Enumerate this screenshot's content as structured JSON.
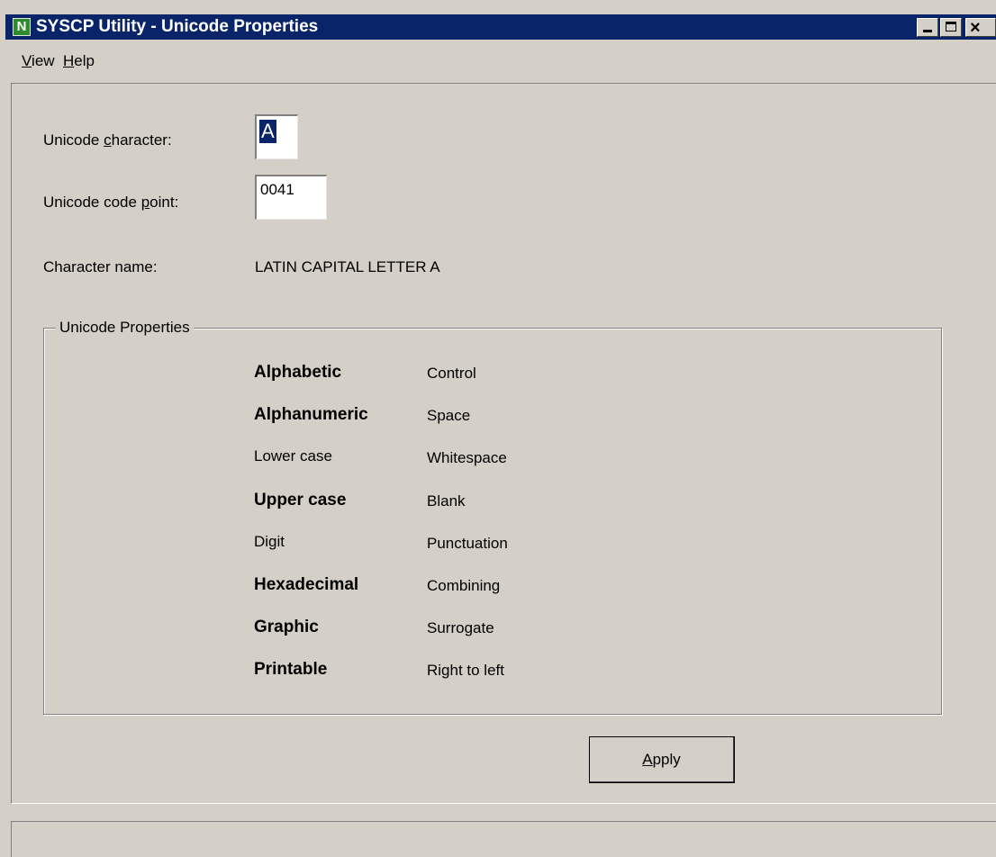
{
  "window": {
    "title": "SYSCP Utility - Unicode Properties",
    "app_icon_letter": "N",
    "controls": [
      "minimize-icon",
      "maximize-icon",
      "close-icon"
    ]
  },
  "menu": {
    "view": {
      "mnemonic": "V",
      "rest": "iew"
    },
    "help": {
      "mnemonic": "H",
      "rest": "elp"
    }
  },
  "form": {
    "char_label": {
      "pre": "Unicode ",
      "mnemonic": "c",
      "post": "haracter:"
    },
    "char_value": "A",
    "codepoint_label": {
      "pre": "Unicode code ",
      "mnemonic": "p",
      "post": "oint:"
    },
    "codepoint_value": "0041",
    "name_label": "Character name:",
    "name_value": "LATIN CAPITAL LETTER A"
  },
  "properties": {
    "legend": "Unicode Properties",
    "left": [
      {
        "label": "Alphabetic",
        "active": true
      },
      {
        "label": "Alphanumeric",
        "active": true
      },
      {
        "label": "Lower case",
        "active": false
      },
      {
        "label": "Upper case",
        "active": true
      },
      {
        "label": "Digit",
        "active": false
      },
      {
        "label": "Hexadecimal",
        "active": true
      },
      {
        "label": "Graphic",
        "active": true
      },
      {
        "label": "Printable",
        "active": true
      }
    ],
    "right": [
      {
        "label": "Control",
        "active": false
      },
      {
        "label": "Space",
        "active": false
      },
      {
        "label": "Whitespace",
        "active": false
      },
      {
        "label": "Blank",
        "active": false
      },
      {
        "label": "Punctuation",
        "active": false
      },
      {
        "label": "Combining",
        "active": false
      },
      {
        "label": "Surrogate",
        "active": false
      },
      {
        "label": "Right to left",
        "active": false
      }
    ]
  },
  "apply": {
    "mnemonic": "A",
    "rest": "pply"
  },
  "colors": {
    "titlebar": "#0a246a",
    "face": "#d4d0c8",
    "selection": "#0a246a"
  }
}
